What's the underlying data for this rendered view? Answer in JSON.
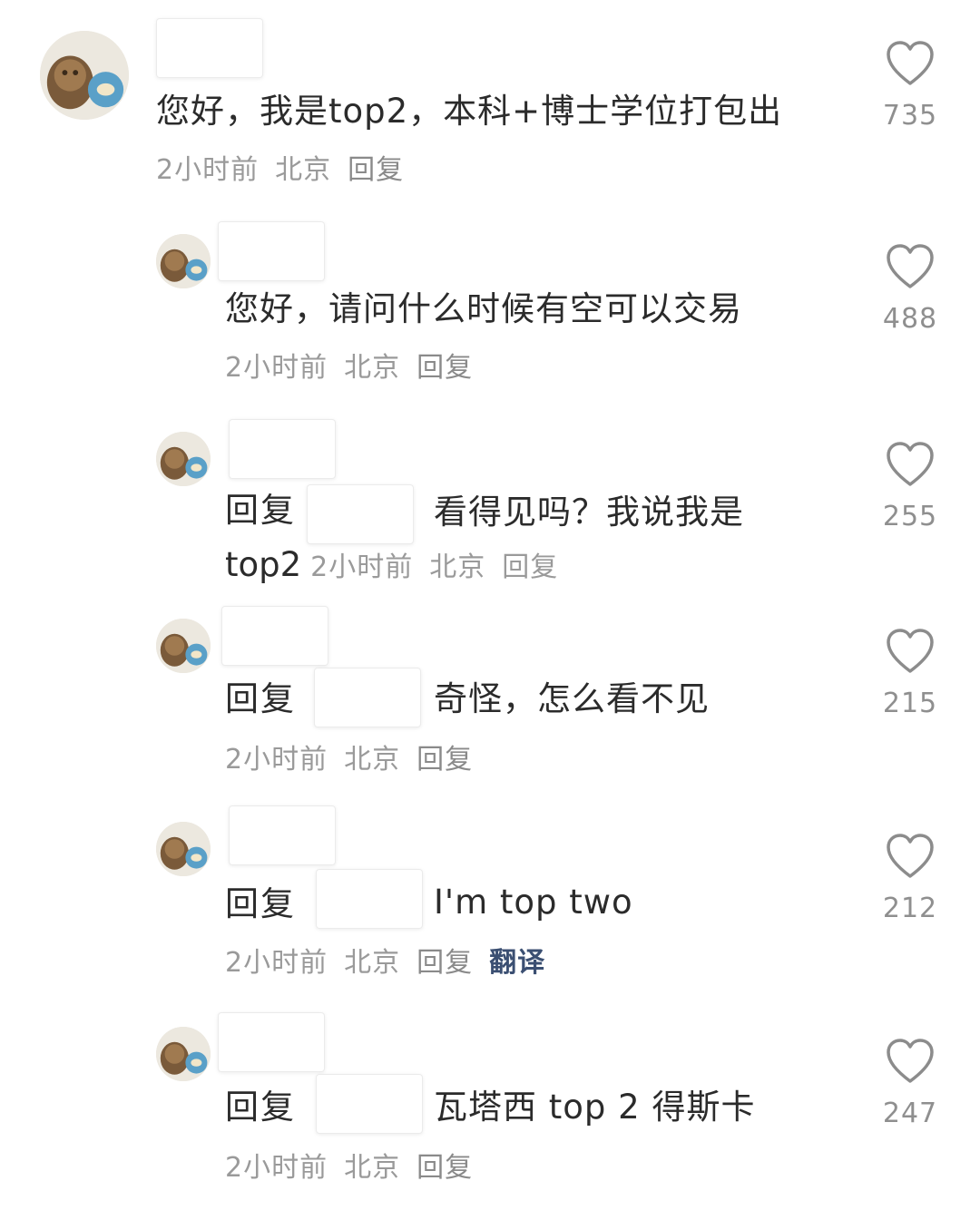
{
  "comments": [
    {
      "text": "您好，我是top2，本科+博士学位打包出",
      "time": "2小时前",
      "location": "北京",
      "reply_label": "回复",
      "likes": "735"
    },
    {
      "text": "您好，请问什么时候有空可以交易",
      "time": "2小时前",
      "location": "北京",
      "reply_label": "回复",
      "likes": "488"
    },
    {
      "prefix": "回复",
      "text": "看得见吗？我说我是",
      "text_cont": "top2",
      "time": "2小时前",
      "location": "北京",
      "reply_label": "回复",
      "likes": "255"
    },
    {
      "prefix": "回复",
      "text": "奇怪，怎么看不见",
      "time": "2小时前",
      "location": "北京",
      "reply_label": "回复",
      "likes": "215"
    },
    {
      "prefix": "回复",
      "text": "I'm top two",
      "time": "2小时前",
      "location": "北京",
      "reply_label": "回复",
      "translate_label": "翻译",
      "likes": "212"
    },
    {
      "prefix": "回复",
      "text": "瓦塔西 top 2 得斯卡",
      "time": "2小时前",
      "location": "北京",
      "reply_label": "回复",
      "likes": "247"
    }
  ],
  "icons": {
    "like": "heart-outline-icon"
  },
  "colors": {
    "text": "#2b2b2b",
    "meta": "#9a9a9a",
    "translate": "#3b4f72",
    "heart_stroke": "#8c8c8c"
  }
}
